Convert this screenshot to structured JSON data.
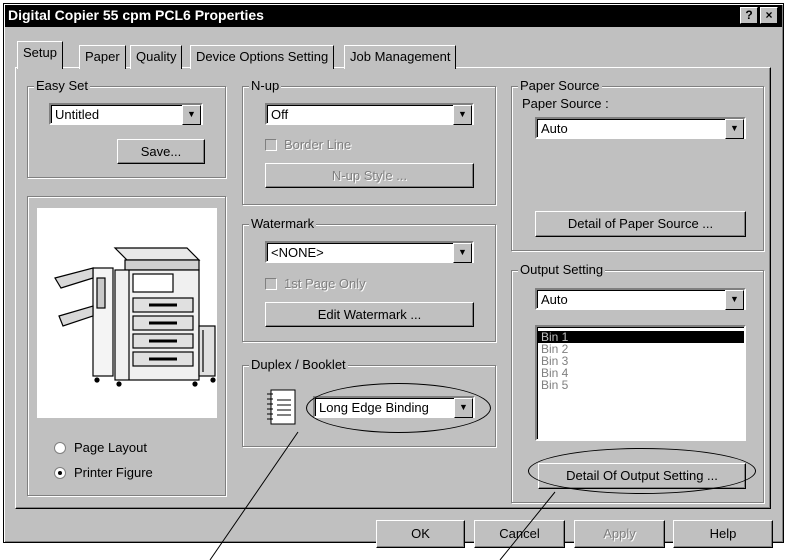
{
  "window": {
    "title": "Digital Copier 55 cpm PCL6 Properties",
    "help_btn": "?",
    "close_btn": "×"
  },
  "tabs": [
    {
      "label": "Setup",
      "active": true
    },
    {
      "label": "Paper"
    },
    {
      "label": "Quality"
    },
    {
      "label": "Device Options Setting"
    },
    {
      "label": "Job Management"
    }
  ],
  "easy_set": {
    "label": "Easy Set",
    "value": "Untitled",
    "save_label": "Save..."
  },
  "nup": {
    "label": "N-up",
    "value": "Off",
    "border_line_label": "Border Line",
    "style_button": "N-up Style ..."
  },
  "watermark": {
    "label": "Watermark",
    "value": "<NONE>",
    "first_page_only_label": "1st Page Only",
    "edit_button": "Edit Watermark ..."
  },
  "duplex": {
    "label": "Duplex / Booklet",
    "value": "Long Edge Binding"
  },
  "paper_source": {
    "group_label": "Paper Source",
    "field_label": "Paper Source :",
    "value": "Auto",
    "detail_button": "Detail of Paper Source ..."
  },
  "output_setting": {
    "label": "Output Setting",
    "value": "Auto",
    "bins": [
      "Bin 1",
      "Bin 2",
      "Bin 3",
      "Bin 4",
      "Bin 5"
    ],
    "detail_button": "Detail Of Output Setting ..."
  },
  "view_options": {
    "page_layout_label": "Page Layout",
    "printer_figure_label": "Printer Figure",
    "selected": "Printer Figure"
  },
  "footer": {
    "ok": "OK",
    "cancel": "Cancel",
    "apply": "Apply",
    "help": "Help"
  }
}
